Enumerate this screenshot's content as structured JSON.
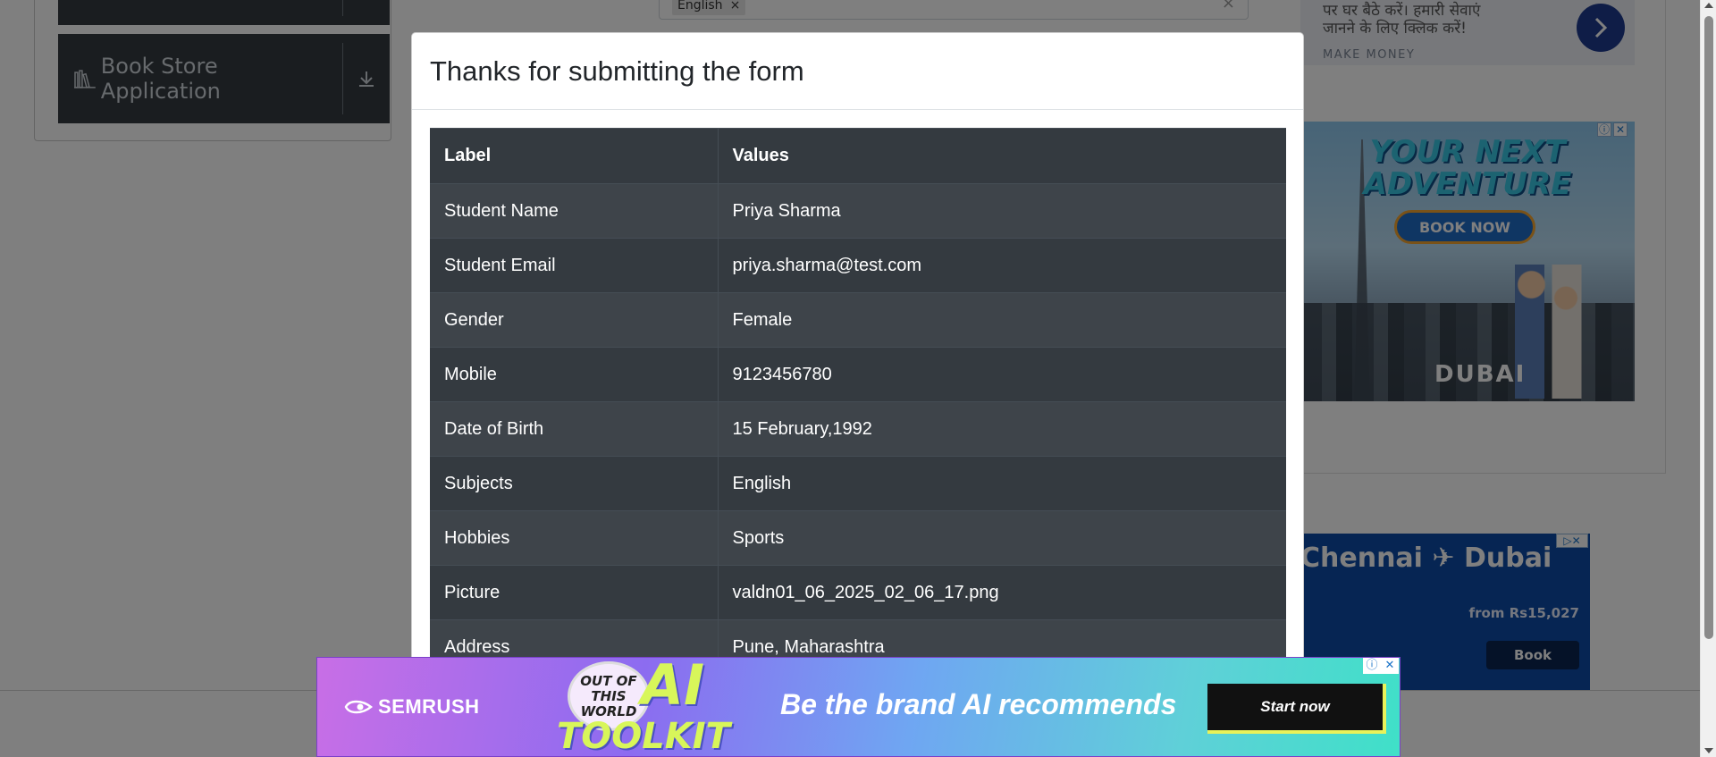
{
  "sidebar": {
    "book_store_label": "Book Store Application"
  },
  "form": {
    "subjects_chip": "English",
    "chip_remove": "×",
    "clear": "×"
  },
  "ads": {
    "top_right": {
      "hindi_line1": "पर घर बैठे करें। हमारी सेवाएं",
      "hindi_line2": "जानने के लिए क्लिक करें!",
      "brand_line": "MAKE MONEY"
    },
    "dubai": {
      "headline_line1": "YOUR NEXT",
      "headline_line2": "ADVENTURE",
      "cta": "BOOK NOW",
      "brand": "DUBAI",
      "close": "✕",
      "info": "ⓘ"
    },
    "flight": {
      "route": "Chennai ✈ Dubai",
      "price": "from Rs15,027",
      "cta": "Book",
      "controls": "▷✕"
    },
    "semrush": {
      "brand": "SEMRUSH",
      "badge": "OUT OF THIS WORLD",
      "ai": "AI",
      "toolkit": "TOOLKIT",
      "tagline": "Be the brand AI recommends",
      "cta": "Start now",
      "info": "ⓘ",
      "close": "✕"
    }
  },
  "modal": {
    "title": "Thanks for submitting the form",
    "table": {
      "headers": [
        "Label",
        "Values"
      ],
      "rows": [
        [
          "Student Name",
          "Priya Sharma"
        ],
        [
          "Student Email",
          "priya.sharma@test.com"
        ],
        [
          "Gender",
          "Female"
        ],
        [
          "Mobile",
          "9123456780"
        ],
        [
          "Date of Birth",
          "15 February,1992"
        ],
        [
          "Subjects",
          "English"
        ],
        [
          "Hobbies",
          "Sports"
        ],
        [
          "Picture",
          "valdn01_06_2025_02_06_17.png"
        ],
        [
          "Address",
          "Pune, Maharashtra"
        ]
      ]
    }
  },
  "colors": {
    "table_dark": "#343a40",
    "table_stripe": "#3e444a",
    "backdrop": "rgba(0,0,0,0.5)"
  }
}
